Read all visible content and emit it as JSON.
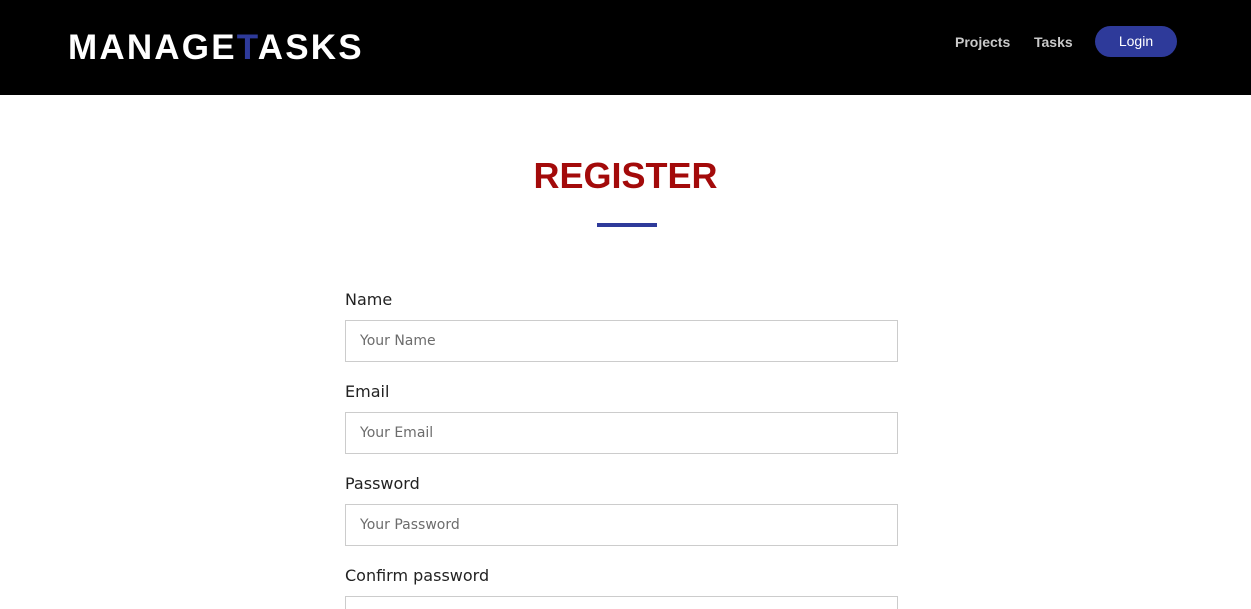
{
  "navbar": {
    "brand_prefix": "MANAGE",
    "brand_accent": "T",
    "brand_suffix": "ASKS",
    "links": {
      "projects": "Projects",
      "tasks": "Tasks"
    },
    "login_label": "Login"
  },
  "page": {
    "title": "REGISTER"
  },
  "form": {
    "name_label": "Name",
    "name_placeholder": "Your Name",
    "email_label": "Email",
    "email_placeholder": "Your Email",
    "password_label": "Password",
    "password_placeholder": "Your Password",
    "confirm_label": "Confirm password"
  },
  "colors": {
    "navbar_bg": "#000000",
    "accent_blue": "#2e3a9a",
    "title_red": "#a30a0a",
    "nav_link": "#c9c9c9",
    "input_border": "#cccccc"
  }
}
